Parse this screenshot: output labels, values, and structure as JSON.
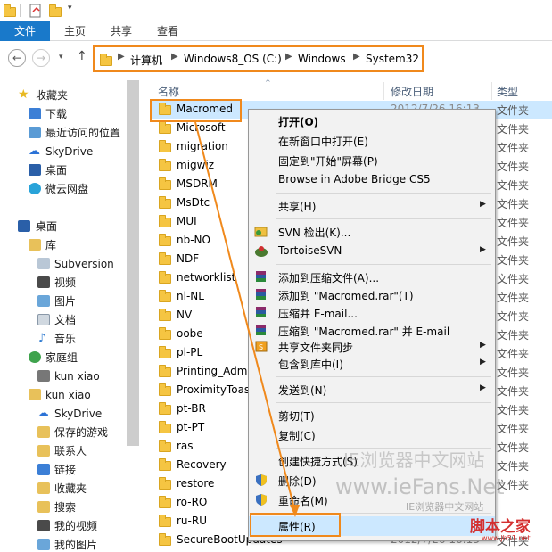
{
  "ribbon": {
    "tabs": [
      "文件",
      "主页",
      "共享",
      "查看"
    ]
  },
  "address": {
    "crumbs": [
      "计算机",
      "Windows8_OS (C:)",
      "Windows",
      "System32"
    ]
  },
  "navpane": {
    "favorites_label": "收藏夹",
    "favorites": [
      "下载",
      "最近访问的位置",
      "SkyDrive",
      "桌面",
      "微云网盘"
    ],
    "desktop_label": "桌面",
    "libraries_label": "库",
    "libraries": [
      "Subversion",
      "视频",
      "图片",
      "文档",
      "音乐"
    ],
    "homegroup": "家庭组",
    "homegroup_user": "kun xiao",
    "user": "kun xiao",
    "user_items": [
      "SkyDrive",
      "保存的游戏",
      "联系人",
      "链接",
      "收藏夹",
      "搜索",
      "我的视频",
      "我的图片"
    ]
  },
  "filelist": {
    "col_name": "名称",
    "col_date": "修改日期",
    "col_type": "类型",
    "files": [
      "Macromed",
      "Microsoft",
      "migration",
      "migwiz",
      "MSDRM",
      "MsDtc",
      "MUI",
      "nb-NO",
      "NDF",
      "networklist",
      "nl-NL",
      "NV",
      "oobe",
      "pl-PL",
      "Printing_Admin",
      "ProximityToast",
      "pt-BR",
      "pt-PT",
      "ras",
      "Recovery",
      "restore",
      "ro-RO",
      "ru-RU",
      "SecureBootUpdates"
    ],
    "date_first": "2012/7/26 16:13",
    "date_last": "2012/7/26 16:13",
    "type_label": "文件夹",
    "visible_types": [
      "文件夹",
      "文件夹",
      "文件夹",
      "文件夹",
      "文件夹",
      "文件夹",
      "文件夹",
      "文件夹",
      "文件夹",
      "文件夹",
      "文件夹",
      "文件夹",
      "文件夹",
      "文件夹",
      "文件夹",
      "文件夹",
      "文件夹",
      "文件夹",
      "文件夹",
      "文件夹",
      "文件夹",
      "",
      "",
      "文件夹"
    ]
  },
  "contextmenu": {
    "open": "打开(O)",
    "open_new": "在新窗口中打开(E)",
    "pin_start": "固定到\"开始\"屏幕(P)",
    "bridge": "Browse in Adobe Bridge CS5",
    "share": "共享(H)",
    "svn_checkout": "SVN 检出(K)...",
    "tortoise": "TortoiseSVN",
    "add_archive": "添加到压缩文件(A)...",
    "add_rar": "添加到 \"Macromed.rar\"(T)",
    "zip_email": "压缩并 E-mail...",
    "zip_rar_email": "压缩到 \"Macromed.rar\" 并 E-mail",
    "share_sync": "共享文件夹同步",
    "include_lib": "包含到库中(I)",
    "send_to": "发送到(N)",
    "cut": "剪切(T)",
    "copy": "复制(C)",
    "shortcut": "创建快捷方式(S)",
    "delete": "删除(D)",
    "rename": "重命名(M)",
    "properties": "属性(R)"
  },
  "watermark": {
    "line1": "IE浏览器中文网站",
    "line2": "www.ieFans.Net",
    "line3": "IE浏览器中文网站",
    "logo": "脚本之家",
    "logo_url": "www.jb51.net"
  },
  "colors": {
    "accent": "#1979ca",
    "highlight_border": "#f0891c",
    "selection": "#cce8ff",
    "folder": "#f5c542"
  }
}
